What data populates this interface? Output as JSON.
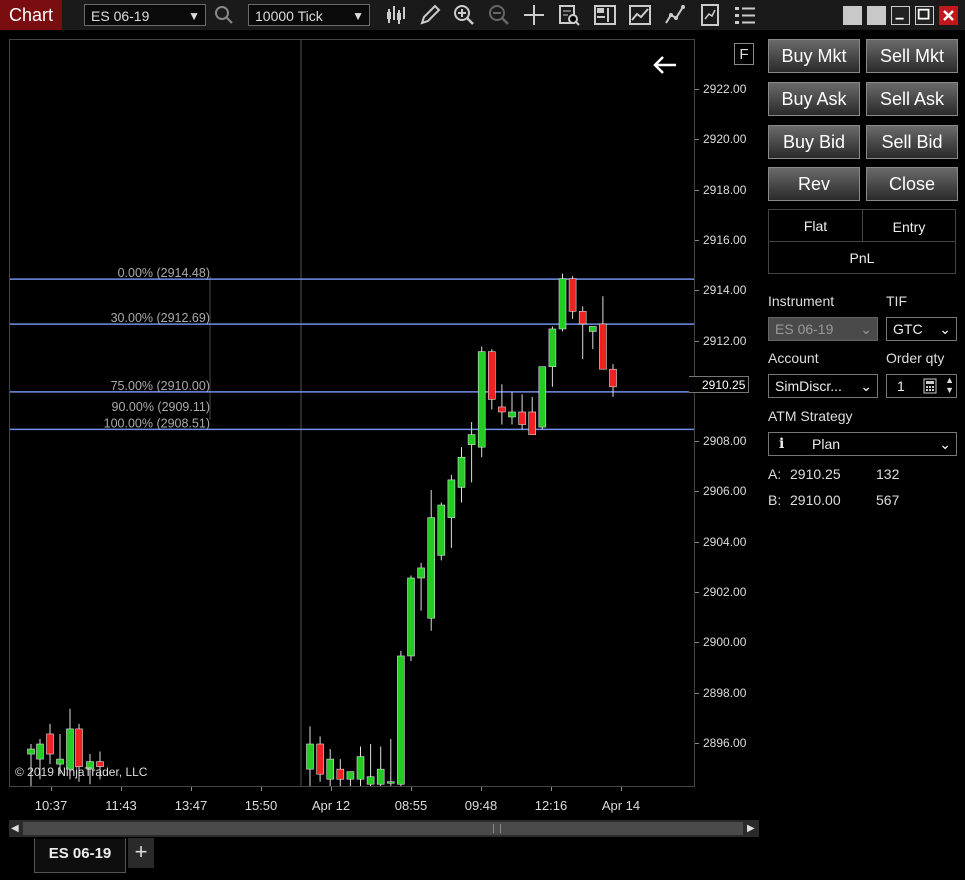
{
  "titlebar": {
    "title": "Chart",
    "instrument": "ES 06-19",
    "interval": "10000 Tick",
    "toolbar_icons": [
      "search-icon",
      "bar-style-icon",
      "drawing-pencil-icon",
      "zoom-in-icon",
      "zoom-out-icon",
      "crosshair-icon",
      "data-box-icon",
      "chart-trader-icon",
      "indicators-icon",
      "strategies-icon",
      "templates-icon",
      "properties-icon"
    ],
    "window_buttons": [
      "gray-square-1",
      "gray-square-2",
      "minimize-icon",
      "maximize-icon",
      "close-icon"
    ]
  },
  "chart": {
    "f_badge": "F",
    "copyright": "© 2019 NinjaTrader, LLC",
    "current_price": "2910.25",
    "price_labels": [
      "2922.00",
      "2920.00",
      "2918.00",
      "2916.00",
      "2914.00",
      "2912.00",
      "2908.00",
      "2906.00",
      "2904.00",
      "2902.00",
      "2900.00",
      "2898.00",
      "2896.00"
    ],
    "time_labels": [
      "10:37",
      "11:43",
      "13:47",
      "15:50",
      "Apr 12",
      "08:55",
      "09:48",
      "12:16",
      "Apr 14"
    ],
    "fib_levels": [
      {
        "label": "0.00% (2914.48)",
        "price": 2914.48
      },
      {
        "label": "30.00% (2912.69)",
        "price": 2912.69
      },
      {
        "label": "75.00% (2910.00)",
        "price": 2910.0
      },
      {
        "label": "90.00% (2909.11)",
        "price": 2909.11
      },
      {
        "label": "100.00% (2908.51)",
        "price": 2908.51
      }
    ],
    "line_color": "#6f8fe8",
    "up_color": "#22cc22",
    "down_color": "#ee2222",
    "candles": [
      {
        "o": 2895.6,
        "h": 2896.0,
        "l": 2894.2,
        "c": 2895.8
      },
      {
        "o": 2895.4,
        "h": 2896.2,
        "l": 2894.6,
        "c": 2896.0
      },
      {
        "o": 2896.4,
        "h": 2896.8,
        "l": 2895.2,
        "c": 2895.6
      },
      {
        "o": 2895.2,
        "h": 2896.4,
        "l": 2894.8,
        "c": 2895.4
      },
      {
        "o": 2895.0,
        "h": 2897.4,
        "l": 2894.6,
        "c": 2896.6
      },
      {
        "o": 2896.6,
        "h": 2896.8,
        "l": 2894.5,
        "c": 2895.1
      },
      {
        "o": 2895.0,
        "h": 2895.6,
        "l": 2894.4,
        "c": 2895.3
      },
      {
        "o": 2895.3,
        "h": 2895.7,
        "l": 2894.6,
        "c": 2895.1
      },
      {
        "o": 2895.0,
        "h": 2896.7,
        "l": 2894.3,
        "c": 2896.0
      },
      {
        "o": 2896.0,
        "h": 2896.3,
        "l": 2894.5,
        "c": 2894.8
      },
      {
        "o": 2894.6,
        "h": 2895.8,
        "l": 2894.3,
        "c": 2895.4
      },
      {
        "o": 2895.0,
        "h": 2895.4,
        "l": 2894.1,
        "c": 2894.6
      },
      {
        "o": 2894.6,
        "h": 2894.9,
        "l": 2894.2,
        "c": 2894.9
      },
      {
        "o": 2894.6,
        "h": 2895.9,
        "l": 2894.1,
        "c": 2895.5
      },
      {
        "o": 2894.4,
        "h": 2896.0,
        "l": 2893.6,
        "c": 2894.7
      },
      {
        "o": 2894.4,
        "h": 2895.9,
        "l": 2893.5,
        "c": 2895.0
      },
      {
        "o": 2894.5,
        "h": 2896.2,
        "l": 2893.7,
        "c": 2894.5
      },
      {
        "o": 2894.4,
        "h": 2899.7,
        "l": 2894.2,
        "c": 2899.5
      },
      {
        "o": 2899.5,
        "h": 2902.7,
        "l": 2899.3,
        "c": 2902.6
      },
      {
        "o": 2902.6,
        "h": 2903.2,
        "l": 2901.3,
        "c": 2903.0
      },
      {
        "o": 2901.0,
        "h": 2906.1,
        "l": 2900.5,
        "c": 2905.0
      },
      {
        "o": 2903.5,
        "h": 2905.6,
        "l": 2903.3,
        "c": 2905.5
      },
      {
        "o": 2905.0,
        "h": 2906.7,
        "l": 2903.8,
        "c": 2906.5
      },
      {
        "o": 2906.2,
        "h": 2907.8,
        "l": 2905.6,
        "c": 2907.4
      },
      {
        "o": 2907.9,
        "h": 2908.8,
        "l": 2906.4,
        "c": 2908.3
      },
      {
        "o": 2907.8,
        "h": 2911.8,
        "l": 2907.4,
        "c": 2911.6
      },
      {
        "o": 2911.6,
        "h": 2911.7,
        "l": 2909.3,
        "c": 2909.7
      },
      {
        "o": 2909.4,
        "h": 2910.3,
        "l": 2908.7,
        "c": 2909.2
      },
      {
        "o": 2909.0,
        "h": 2910.0,
        "l": 2908.7,
        "c": 2909.2
      },
      {
        "o": 2909.2,
        "h": 2909.9,
        "l": 2908.5,
        "c": 2908.7
      },
      {
        "o": 2909.2,
        "h": 2909.8,
        "l": 2908.3,
        "c": 2908.3
      },
      {
        "o": 2908.6,
        "h": 2911.0,
        "l": 2908.5,
        "c": 2911.0
      },
      {
        "o": 2911.0,
        "h": 2912.6,
        "l": 2910.2,
        "c": 2912.5
      },
      {
        "o": 2912.5,
        "h": 2914.7,
        "l": 2912.4,
        "c": 2914.5
      },
      {
        "o": 2914.5,
        "h": 2914.6,
        "l": 2912.9,
        "c": 2913.2
      },
      {
        "o": 2913.2,
        "h": 2913.4,
        "l": 2911.3,
        "c": 2912.7
      },
      {
        "o": 2912.4,
        "h": 2912.6,
        "l": 2911.7,
        "c": 2912.6
      },
      {
        "o": 2912.7,
        "h": 2913.8,
        "l": 2911.4,
        "c": 2910.9
      },
      {
        "o": 2910.9,
        "h": 2911.1,
        "l": 2909.8,
        "c": 2910.2
      }
    ]
  },
  "panel": {
    "buttons": {
      "buy_mkt": "Buy Mkt",
      "sell_mkt": "Sell Mkt",
      "buy_ask": "Buy Ask",
      "sell_ask": "Sell Ask",
      "buy_bid": "Buy Bid",
      "sell_bid": "Sell Bid",
      "rev": "Rev",
      "close": "Close"
    },
    "position": {
      "flat": "Flat",
      "entry": "Entry",
      "pnl": "PnL"
    },
    "instrument_label": "Instrument",
    "instrument_value": "ES 06-19",
    "tif_label": "TIF",
    "tif_value": "GTC",
    "account_label": "Account",
    "account_value": "SimDiscr...",
    "orderqty_label": "Order qty",
    "orderqty_value": "1",
    "atm_label": "ATM Strategy",
    "atm_value": "Plan",
    "ask_label": "A:",
    "ask_price": "2910.25",
    "ask_size": "132",
    "bid_label": "B:",
    "bid_price": "2910.00",
    "bid_size": "567"
  },
  "tabs": {
    "active": "ES 06-19",
    "add": "+"
  }
}
